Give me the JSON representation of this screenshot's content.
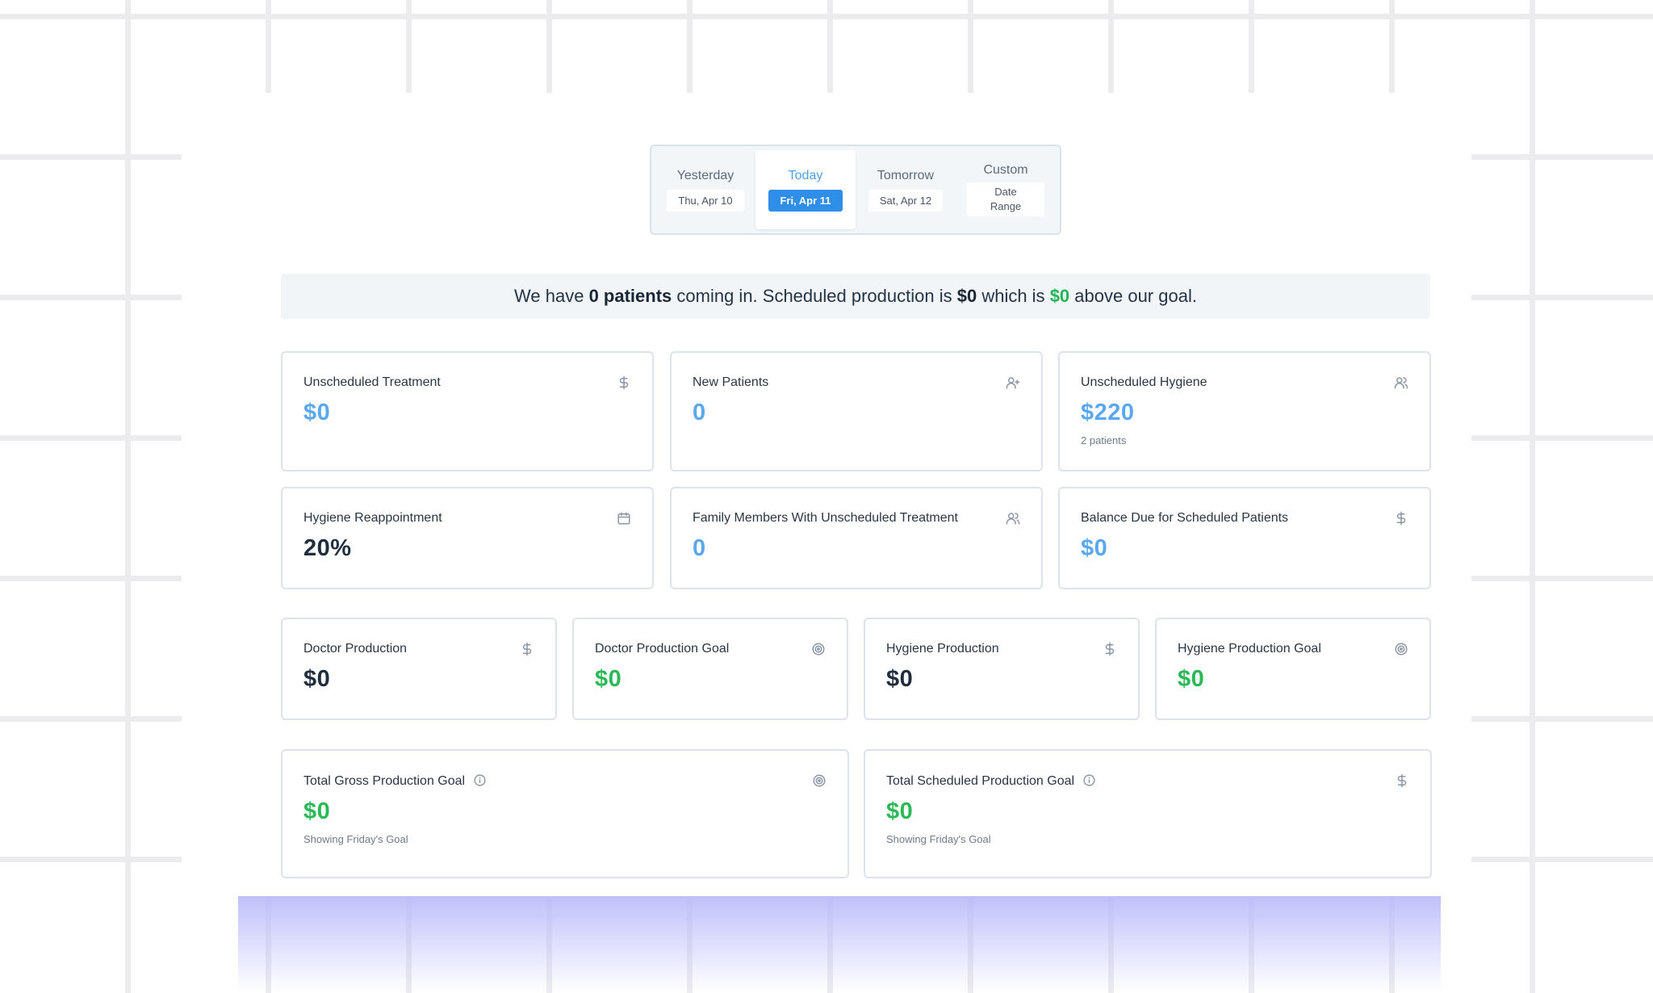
{
  "date_selector": {
    "tabs": [
      {
        "label": "Yesterday",
        "date": "Thu, Apr 10"
      },
      {
        "label": "Today",
        "date": "Fri, Apr 11"
      },
      {
        "label": "Tomorrow",
        "date": "Sat, Apr 12"
      },
      {
        "label": "Custom",
        "date": "Date Range"
      }
    ],
    "active_tab": "Today"
  },
  "summary": {
    "p1": "We have ",
    "patients": "0 patients",
    "p2": " coming in. Scheduled production is ",
    "production": "$0",
    "p3": " which is ",
    "above": "$0",
    "p4": " above our goal."
  },
  "cards": {
    "unscheduled_treatment": {
      "label": "Unscheduled Treatment",
      "value": "$0",
      "icon": "dollar-icon"
    },
    "new_patients": {
      "label": "New Patients",
      "value": "0",
      "icon": "user-plus-icon"
    },
    "unscheduled_hygiene": {
      "label": "Unscheduled Hygiene",
      "value": "$220",
      "sub": "2 patients",
      "icon": "users-icon"
    },
    "hygiene_reappointment": {
      "label": "Hygiene Reappointment",
      "value": "20%",
      "icon": "calendar-icon"
    },
    "family_members": {
      "label": "Family Members With Unscheduled Treatment",
      "value": "0",
      "icon": "users-icon"
    },
    "balance_due": {
      "label": "Balance Due for Scheduled Patients",
      "value": "$0",
      "icon": "dollar-icon"
    },
    "doctor_production": {
      "label": "Doctor Production",
      "value": "$0",
      "icon": "dollar-icon"
    },
    "doctor_production_goal": {
      "label": "Doctor Production Goal",
      "value": "$0",
      "icon": "target-icon"
    },
    "hygiene_production": {
      "label": "Hygiene Production",
      "value": "$0",
      "icon": "dollar-icon"
    },
    "hygiene_production_goal": {
      "label": "Hygiene Production Goal",
      "value": "$0",
      "icon": "target-icon"
    },
    "total_gross_goal": {
      "label": "Total Gross Production Goal",
      "value": "$0",
      "sub": "Showing Friday's Goal",
      "icon": "target-icon"
    },
    "total_scheduled_goal": {
      "label": "Total Scheduled Production Goal",
      "value": "$0",
      "sub": "Showing Friday's Goal",
      "icon": "dollar-icon"
    }
  },
  "colors": {
    "accent_blue": "#2f8fe8",
    "value_blue": "#5aa8ef",
    "value_green": "#2bb956",
    "text_dark": "#1f2d3d"
  }
}
